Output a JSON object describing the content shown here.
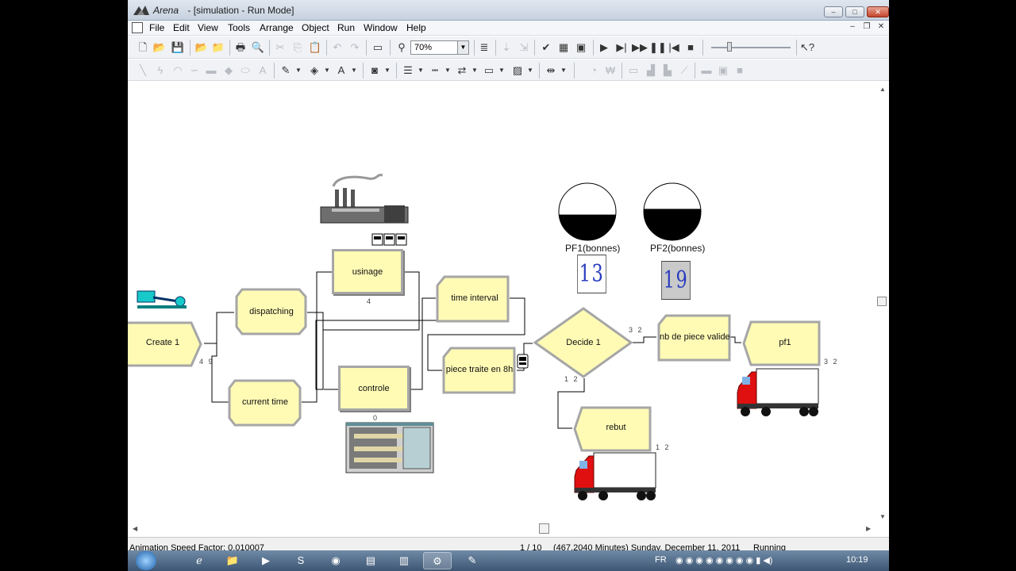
{
  "window": {
    "app_name": "Arena",
    "title": "- [simulation - Run Mode]",
    "controls": {
      "minimize": "–",
      "maximize": "□",
      "close": "✕"
    }
  },
  "menu": {
    "items": [
      "File",
      "Edit",
      "View",
      "Tools",
      "Arrange",
      "Object",
      "Run",
      "Window",
      "Help"
    ],
    "mdi_controls": [
      "–",
      "❐",
      "✕"
    ]
  },
  "toolbar": {
    "zoom_value": "70%"
  },
  "modules": {
    "create": {
      "label": "Create 1",
      "count": "4 9"
    },
    "dispatching": {
      "label": "dispatching"
    },
    "current_time": {
      "label": "current time"
    },
    "usinage": {
      "label": "usinage",
      "count": "4"
    },
    "controle": {
      "label": "controle",
      "count": "0"
    },
    "time_interval": {
      "label": "time interval"
    },
    "piece_traite": {
      "label": "piece traite en 8h"
    },
    "decide": {
      "label": "Decide 1",
      "count_true": "3 2",
      "count_false": "1 2"
    },
    "nb_piece_valide": {
      "label": "nb de piece valide"
    },
    "pf1": {
      "label": "pf1",
      "count": "3 2"
    },
    "rebut": {
      "label": "rebut",
      "count": "1 2"
    }
  },
  "animation": {
    "pf1_label": "PF1(bonnes)",
    "pf2_label": "PF2(bonnes)",
    "pf1_counter": "13",
    "pf2_counter": "19",
    "pf1_level": 0.45,
    "pf2_level": 0.55
  },
  "status": {
    "speed": "Animation Speed Factor: 0.010007",
    "replication": "1 / 10",
    "time": "(467.2040 Minutes) Sunday, December 11, 2011",
    "state": "Running"
  },
  "taskbar": {
    "language": "FR",
    "clock": "10:19"
  },
  "colors": {
    "module_fill": "#fffbb5",
    "module_border": "#a6a6a6",
    "counter_digits": "#2b3dbf",
    "truck_red": "#e01010"
  }
}
